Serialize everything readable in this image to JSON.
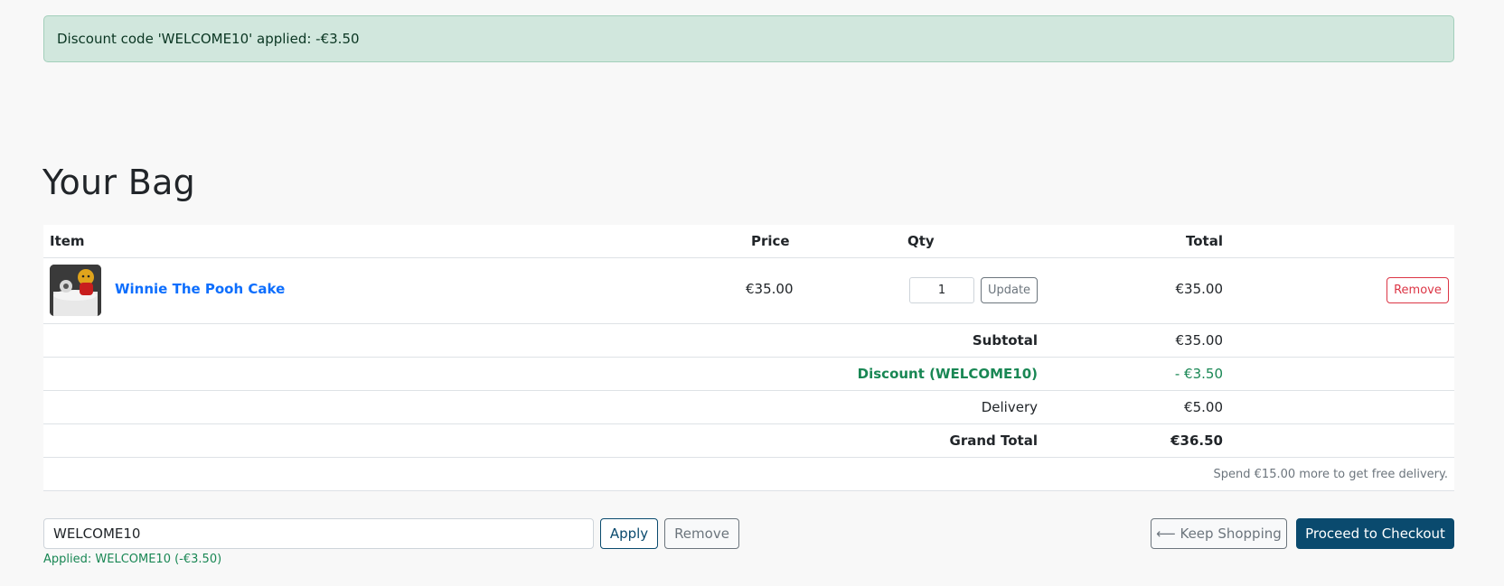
{
  "alert": {
    "message": "Discount code 'WELCOME10' applied: -€3.50"
  },
  "page": {
    "title": "Your Bag"
  },
  "table": {
    "headers": {
      "item": "Item",
      "price": "Price",
      "qty": "Qty",
      "total": "Total"
    },
    "items": [
      {
        "name": "Winnie The Pooh Cake",
        "price": "€35.00",
        "qty": "1",
        "update_label": "Update",
        "total": "€35.00",
        "remove_label": "Remove"
      }
    ],
    "summary": {
      "subtotal_label": "Subtotal",
      "subtotal_value": "€35.00",
      "discount_label": "Discount (WELCOME10)",
      "discount_value": "- €3.50",
      "delivery_label": "Delivery",
      "delivery_value": "€5.00",
      "grand_total_label": "Grand Total",
      "grand_total_value": "€36.50"
    },
    "free_delivery_note": "Spend €15.00 more to get free delivery."
  },
  "promo": {
    "code_value": "WELCOME10",
    "apply_label": "Apply",
    "remove_label": "Remove",
    "applied_message": "Applied: WELCOME10 (-€3.50)"
  },
  "actions": {
    "keep_shopping_label": "⟵ Keep Shopping",
    "checkout_label": "Proceed to Checkout"
  },
  "colors": {
    "alert_bg": "#d1e7dd",
    "link": "#0d6efd",
    "discount_green": "#198754",
    "danger": "#dc3545",
    "primary_dark": "#0a4a6e"
  },
  "icons": {
    "product_image": "winnie-the-pooh-cake-thumbnail"
  }
}
